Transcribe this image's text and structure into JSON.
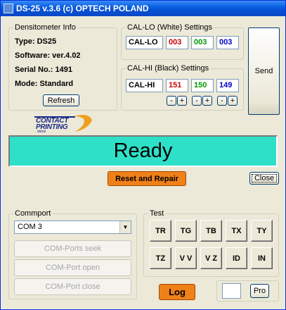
{
  "window": {
    "title": "DS-25  v.3.6  (c) OPTECH POLAND"
  },
  "densito": {
    "legend": "Densitometer Info",
    "type": "Type: DS25",
    "software": "Software: ver.4.02",
    "serial": "Serial No.: 1491",
    "mode": "Mode: Standard",
    "refresh": "Refresh"
  },
  "cal_lo": {
    "legend": "CAL-LO (White) Settings",
    "name": "CAL-LO",
    "r": "003",
    "g": "003",
    "b": "003"
  },
  "cal_hi": {
    "legend": "CAL-HI (Black) Settings",
    "name": "CAL-HI",
    "r": "151",
    "g": "150",
    "b": "149"
  },
  "stepper": {
    "minus": "-",
    "plus": "+"
  },
  "send": "Send",
  "logo": {
    "line1": "CONTACT",
    "line2": "PRINTING",
    "line3": "dstrel"
  },
  "status": "Ready",
  "reset_button": "Reset and Repair",
  "close_button": "Close",
  "comport": {
    "legend": "Commport",
    "selected": "COM 3",
    "seek": "COM-Ports seek",
    "open": "COM-Port open",
    "close": "COM-Port close"
  },
  "test": {
    "legend": "Test",
    "buttons": [
      "TR",
      "TG",
      "TB",
      "TX",
      "TY",
      "TZ",
      "V V",
      "V Z",
      "ID",
      "IN"
    ]
  },
  "log_button": "Log",
  "pro_button": "Pro",
  "colors": {
    "red": "#cc0000",
    "green": "#009900",
    "blue": "#0000cc",
    "orange": "#f08018",
    "cyan": "#2ee0c8"
  }
}
